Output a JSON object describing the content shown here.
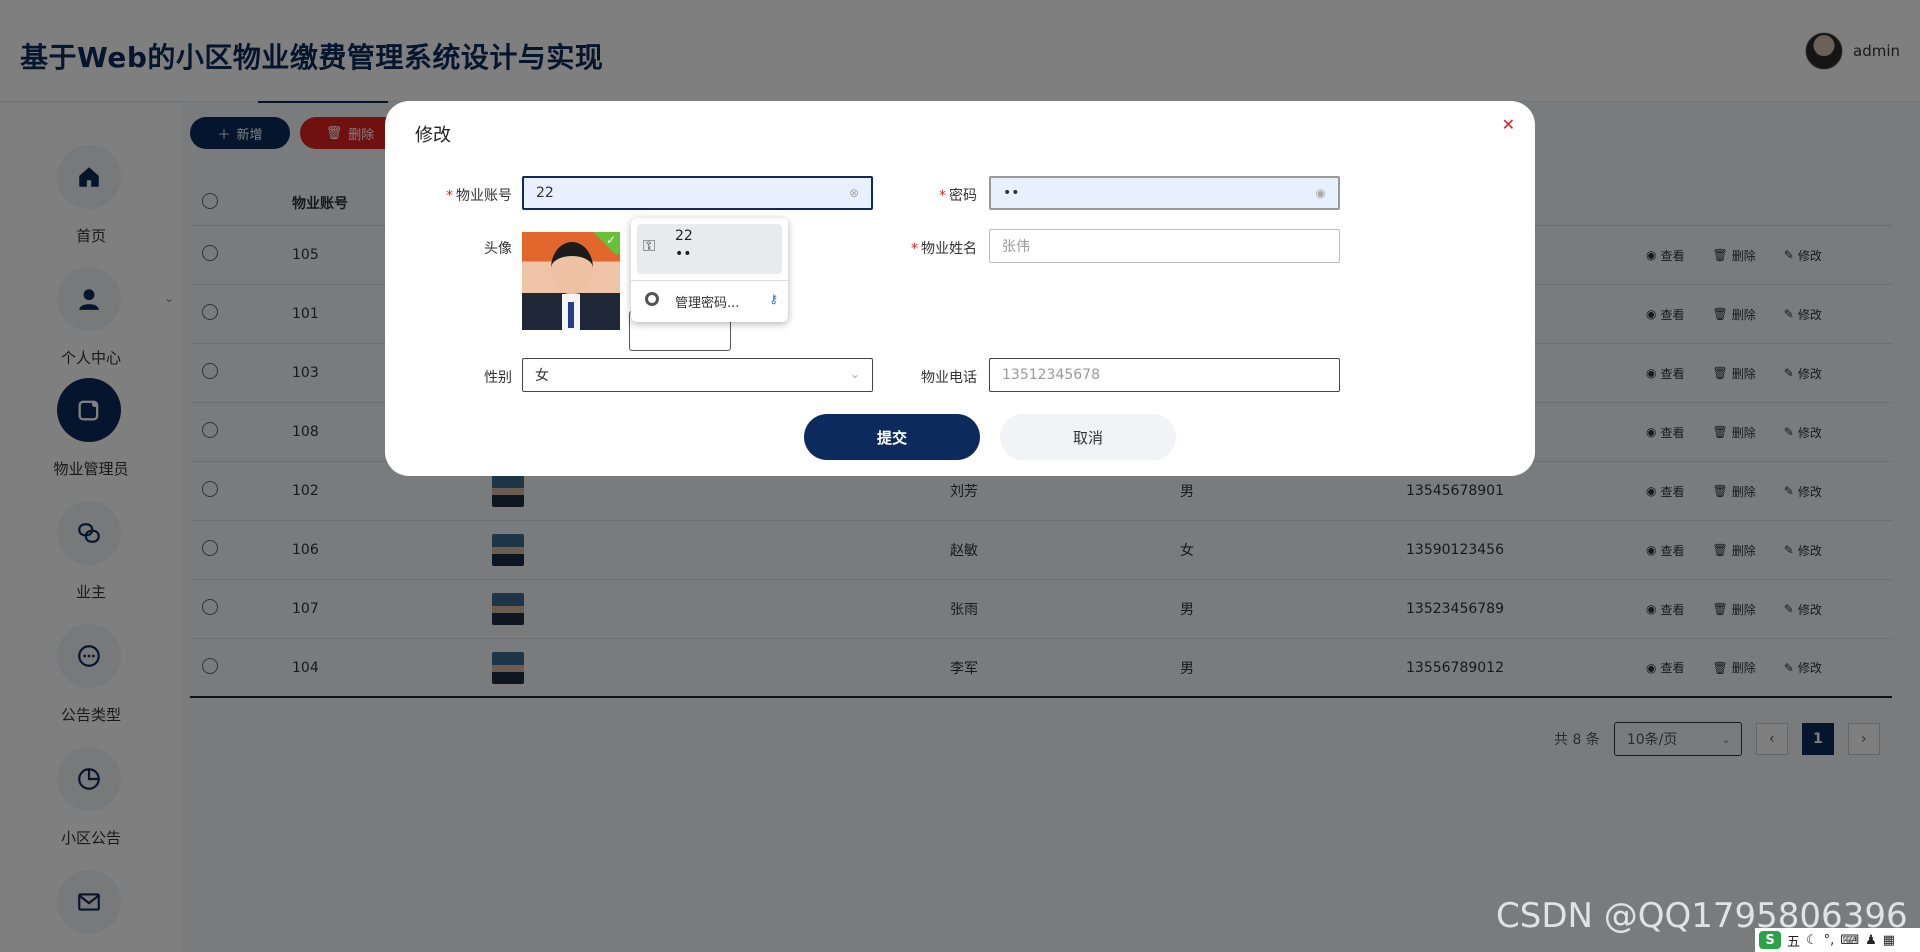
{
  "header": {
    "title": "基于Web的小区物业缴费管理系统设计与实现",
    "username": "admin"
  },
  "sidebar": {
    "items": [
      {
        "label": "首页",
        "icon": "home-icon"
      },
      {
        "label": "个人中心",
        "icon": "user-icon"
      },
      {
        "label": "物业管理员",
        "icon": "manager-icon",
        "active": true
      },
      {
        "label": "业主",
        "icon": "owner-icon"
      },
      {
        "label": "公告类型",
        "icon": "chat-icon"
      },
      {
        "label": "小区公告",
        "icon": "pie-chart-icon"
      },
      {
        "label": "",
        "icon": "mail-icon"
      }
    ]
  },
  "toolbar": {
    "add_label": "新增",
    "delete_label": "删除"
  },
  "table": {
    "columns": [
      "物业账号"
    ],
    "rows": [
      {
        "account": "105",
        "name": "",
        "sex": "",
        "phone": ""
      },
      {
        "account": "101",
        "name": "",
        "sex": "",
        "phone": ""
      },
      {
        "account": "103",
        "name": "",
        "sex": "",
        "phone": ""
      },
      {
        "account": "108",
        "name": "",
        "sex": "",
        "phone": ""
      },
      {
        "account": "102",
        "name": "刘芳",
        "sex": "男",
        "phone": "13545678901"
      },
      {
        "account": "106",
        "name": "赵敏",
        "sex": "女",
        "phone": "13590123456"
      },
      {
        "account": "107",
        "name": "张雨",
        "sex": "男",
        "phone": "13523456789"
      },
      {
        "account": "104",
        "name": "李军",
        "sex": "男",
        "phone": "13556789012"
      }
    ],
    "ops": {
      "view": "查看",
      "delete": "删除",
      "edit": "修改"
    }
  },
  "pager": {
    "total": "共 8 条",
    "page_size": "10条/页",
    "current": "1"
  },
  "modal": {
    "title": "修改",
    "fields": {
      "account_label": "物业账号",
      "account_value": "22",
      "password_label": "密码",
      "password_value": "••",
      "avatar_label": "头像",
      "name_label": "物业姓名",
      "name_placeholder": "张伟",
      "sex_label": "性别",
      "sex_value": "女",
      "phone_label": "物业电话",
      "phone_placeholder": "13512345678"
    },
    "submit_label": "提交",
    "cancel_label": "取消"
  },
  "autofill": {
    "username": "22",
    "password": "••",
    "manage_label": "管理密码..."
  },
  "watermark": "CSDN @QQ1795806396",
  "tray": {
    "ime": "五"
  },
  "colors": {
    "primary": "#0d2a5c",
    "danger": "#e02020",
    "success": "#67c23a"
  }
}
